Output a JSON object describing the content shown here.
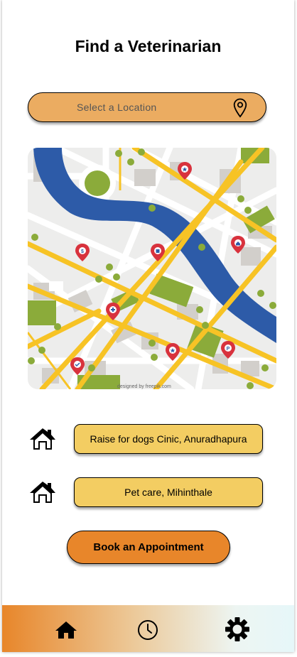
{
  "header": {
    "title": "Find a Veterinarian"
  },
  "location": {
    "placeholder": "Select a Location",
    "icon": "location-pin-icon"
  },
  "map": {
    "credit": "designed by freepik.com"
  },
  "clinics": [
    {
      "name": "Raise for dogs Cinic, Anuradhapura",
      "icon": "home-icon"
    },
    {
      "name": "Pet care, Mihinthale",
      "icon": "home-icon"
    }
  ],
  "actions": {
    "book_label": "Book an Appointment"
  },
  "nav": {
    "items": [
      {
        "name": "home",
        "icon": "home-icon"
      },
      {
        "name": "history",
        "icon": "clock-icon"
      },
      {
        "name": "settings",
        "icon": "gear-icon"
      }
    ]
  },
  "colors": {
    "location_bg": "#ebac61",
    "clinic_bg": "#f3cd62",
    "book_bg": "#e8862a",
    "river": "#2d5ba8",
    "road": "#f7c325",
    "park": "#8bab3a",
    "pin": "#d8323d"
  }
}
